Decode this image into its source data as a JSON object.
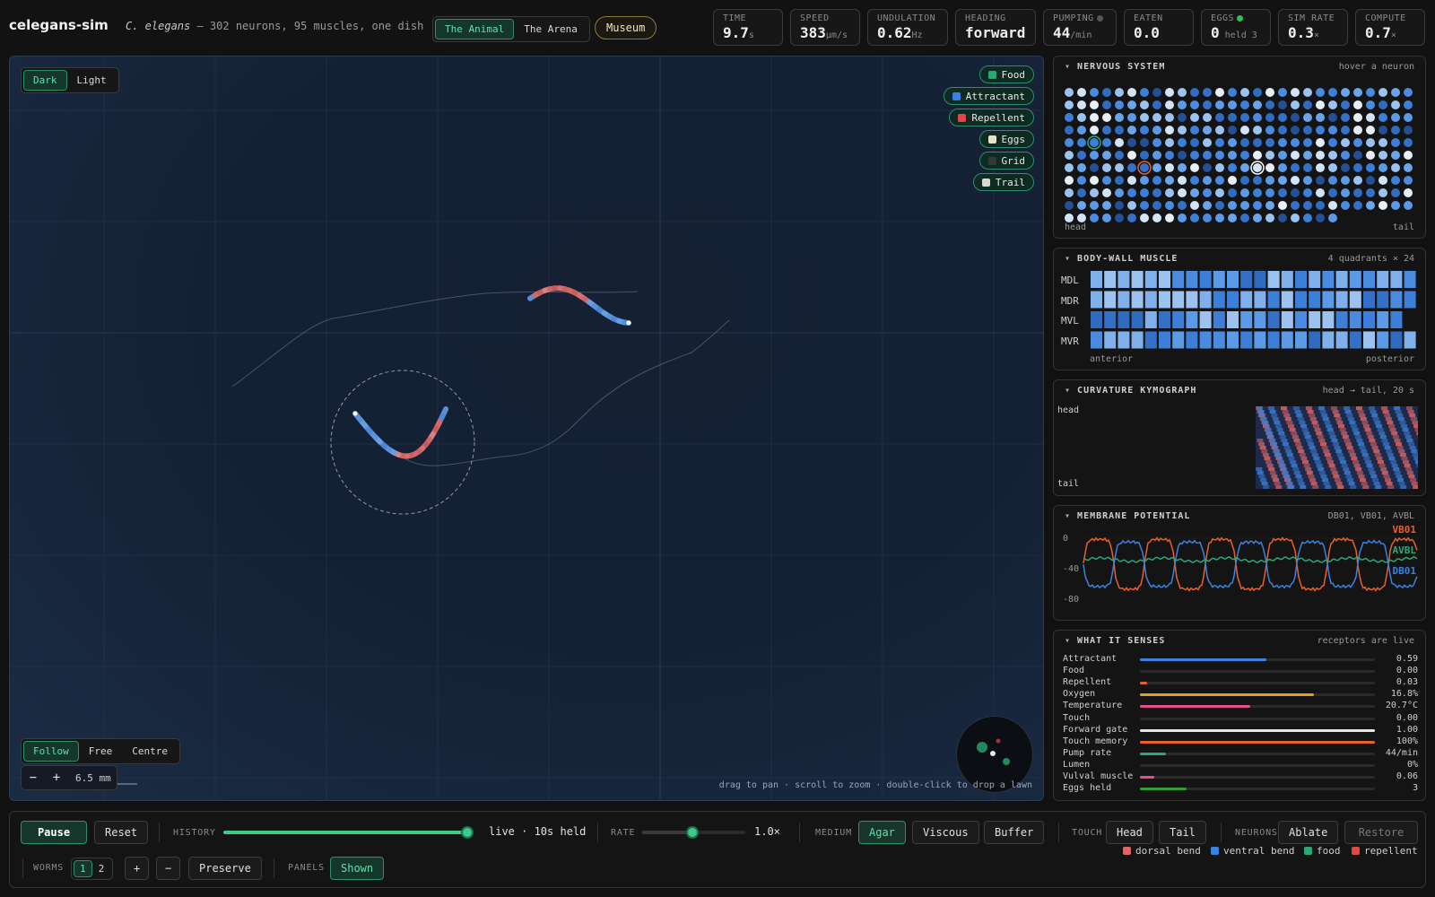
{
  "app": {
    "title": "celegans-sim",
    "subtitle_species": "C. elegans",
    "subtitle_rest": " — 302 neurons, 95 muscles, one dish"
  },
  "view_toggle": {
    "options": [
      "The Animal",
      "The Arena"
    ],
    "selected": "The Animal"
  },
  "museum_label": "Museum",
  "stats": [
    {
      "label": "TIME",
      "value": "9.7",
      "unit": "s"
    },
    {
      "label": "SPEED",
      "value": "383",
      "unit": "µm/s"
    },
    {
      "label": "UNDULATION",
      "value": "0.62",
      "unit": "Hz"
    },
    {
      "label": "HEADING",
      "value": "forward",
      "unit": ""
    },
    {
      "label": "PUMPING",
      "value": "44",
      "unit": "/min"
    },
    {
      "label": "EATEN",
      "value": "0.0",
      "unit": ""
    },
    {
      "label": "EGGS",
      "value": "0",
      "unit": " held 3"
    },
    {
      "label": "SIM RATE",
      "value": "0.3",
      "unit": "×"
    },
    {
      "label": "COMPUTE",
      "value": "0.7",
      "unit": "×"
    }
  ],
  "stat_indicators": {
    "pumping_dot": "#555555",
    "eggs_dot": "#2fbf5a"
  },
  "theme_toggle": {
    "options": [
      "Dark",
      "Light"
    ],
    "selected": "Dark"
  },
  "layers": [
    {
      "label": "Food",
      "color": "#2aa876"
    },
    {
      "label": "Attractant",
      "color": "#3b82e0"
    },
    {
      "label": "Repellent",
      "color": "#e04848"
    },
    {
      "label": "Eggs",
      "color": "#e8e2c8"
    },
    {
      "label": "Grid",
      "color": "#2f3a33"
    },
    {
      "label": "Trail",
      "color": "#d8d8d0"
    }
  ],
  "camera_toggle": {
    "options": [
      "Follow",
      "Free",
      "Centre"
    ],
    "selected": "Follow"
  },
  "zoom": {
    "minus": "−",
    "plus": "+",
    "value": "6.5 mm"
  },
  "hint": "drag to pan · scroll to zoom · double-click to drop a lawn",
  "panels": {
    "nervous": {
      "title": "NERVOUS SYSTEM",
      "note": "hover a neuron",
      "left": "head",
      "right": "tail"
    },
    "muscle": {
      "title": "BODY-WALL MUSCLE",
      "note": "4 quadrants × 24",
      "rows": [
        "MDL",
        "MDR",
        "MVL",
        "MVR"
      ],
      "left": "anterior",
      "right": "posterior"
    },
    "kymo": {
      "title": "CURVATURE KYMOGRAPH",
      "note": "head → tail, 20 s",
      "top": "head",
      "bottom": "tail"
    },
    "vm": {
      "title": "MEMBRANE POTENTIAL",
      "note": "DB01, VB01, AVBL",
      "yticks": [
        "0",
        "-40",
        "-80"
      ],
      "traces": [
        {
          "name": "VB01",
          "color": "#e8602c"
        },
        {
          "name": "AVBL",
          "color": "#2aa876"
        },
        {
          "name": "DB01",
          "color": "#3b82e0"
        }
      ]
    },
    "senses": {
      "title": "WHAT IT SENSES",
      "note": "receptors are live",
      "rows": [
        {
          "label": "Attractant",
          "value": "0.59",
          "level": 0.54,
          "color": "#3b82e0"
        },
        {
          "label": "Food",
          "value": "0.00",
          "level": 0.0,
          "color": "#2aa876"
        },
        {
          "label": "Repellent",
          "value": "0.03",
          "level": 0.03,
          "color": "#e8602c"
        },
        {
          "label": "Oxygen",
          "value": "16.8%",
          "level": 0.74,
          "color": "#e0a020"
        },
        {
          "label": "Temperature",
          "value": "20.7°C",
          "level": 0.47,
          "color": "#e0508a"
        },
        {
          "label": "Touch",
          "value": "0.00",
          "level": 0.0,
          "color": "#999999"
        },
        {
          "label": "Forward gate",
          "value": "1.00",
          "level": 1.0,
          "color": "#e6e6e6"
        },
        {
          "label": "Touch memory",
          "value": "100%",
          "level": 1.0,
          "color": "#e8602c"
        },
        {
          "label": "Pump rate",
          "value": "44/min",
          "level": 0.11,
          "color": "#2aa876"
        },
        {
          "label": "Lumen",
          "value": "0%",
          "level": 0.0,
          "color": "#999999"
        },
        {
          "label": "Vulval muscle",
          "value": "0.06",
          "level": 0.06,
          "color": "#e0508a"
        },
        {
          "label": "Eggs held",
          "value": "3",
          "level": 0.2,
          "color": "#2fa02f"
        }
      ]
    }
  },
  "controls": {
    "pause": "Pause",
    "reset": "Reset",
    "history_label": "HISTORY",
    "history_value": "live · 10s held",
    "history_level": 1.0,
    "rate_label": "RATE",
    "rate_value": "1.0×",
    "rate_level": 0.49,
    "medium_label": "MEDIUM",
    "medium_options": [
      "Agar",
      "Viscous",
      "Buffer"
    ],
    "medium_selected": "Agar",
    "touch_label": "TOUCH",
    "touch_options": [
      "Head",
      "Tail"
    ],
    "neurons_label": "NEURONS",
    "ablate": "Ablate",
    "restore": "Restore",
    "worms_label": "WORMS",
    "worm_options": [
      "1",
      "2"
    ],
    "worm_selected": "1",
    "add": "+",
    "remove": "−",
    "preserve": "Preserve",
    "panels_label": "PANELS",
    "panels_value": "Shown"
  },
  "legend": [
    {
      "label": "dorsal bend",
      "color": "#e06666"
    },
    {
      "label": "ventral bend",
      "color": "#3b82e0"
    },
    {
      "label": "food",
      "color": "#2aa876"
    },
    {
      "label": "repellent",
      "color": "#e04848"
    }
  ]
}
